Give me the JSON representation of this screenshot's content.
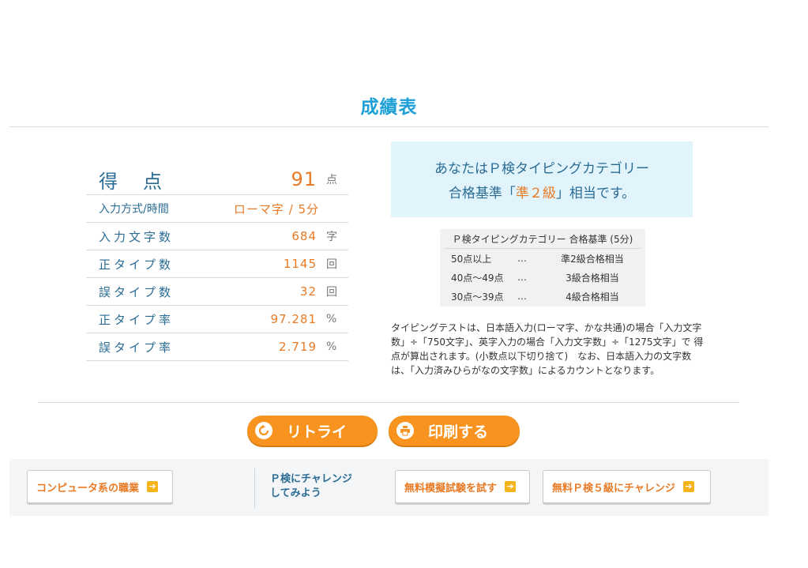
{
  "page_title": "成績表",
  "score_table": {
    "score": {
      "label_a": "得",
      "label_b": "点",
      "value": "91",
      "unit": "点"
    },
    "mode": {
      "label": "入力方式/時間",
      "value": "ローマ字 / 5分"
    },
    "rows": [
      {
        "label": "入力文字数",
        "value": "684",
        "unit": "字"
      },
      {
        "label": "正タイプ数",
        "value": "1145",
        "unit": "回"
      },
      {
        "label": "誤タイプ数",
        "value": "32",
        "unit": "回"
      },
      {
        "label": "正タイプ率",
        "value": "97.281",
        "unit": "%"
      },
      {
        "label": "誤タイプ率",
        "value": "2.719",
        "unit": "%"
      }
    ]
  },
  "result": {
    "line1": "あなたはＰ検タイピングカテゴリー",
    "line2_pre": "合格基準「",
    "grade": "準２級",
    "line2_post": "」相当です。"
  },
  "criteria": {
    "header": "Ｐ検タイピングカテゴリー 合格基準 (5分)",
    "rows": [
      {
        "range": "50点以上",
        "dots": "…",
        "grade": "準2級合格相当"
      },
      {
        "range": "40点～49点",
        "dots": "…",
        "grade": "3級合格相当"
      },
      {
        "range": "30点～39点",
        "dots": "…",
        "grade": "4級合格相当"
      }
    ]
  },
  "note": "タイピングテストは、日本語入力(ローマ字、かな共通)の場合「入力文字数」÷「750文字」、英字入力の場合「入力文字数」÷「1275文字」で 得点が算出されます。(小数点以下切り捨て)　なお、日本語入力の文字数は、「入力済みひらがなの文字数」によるカウントとなります。",
  "buttons": {
    "retry": "リトライ",
    "print": "印刷する"
  },
  "footer": {
    "computer_jobs": "コンピュータ系の職業",
    "challenge_msg_line1": "Ｐ検にチャレンジ",
    "challenge_msg_line2": "してみよう",
    "mock_exam": "無料模擬試験を試す",
    "level5": "無料Ｐ検５級にチャレンジ"
  },
  "icons": {
    "retry": "retry-icon",
    "print": "printer-icon",
    "arrow": "arrow-right-icon"
  },
  "colors": {
    "accent_blue": "#1ca0d6",
    "label_blue": "#2b6c95",
    "orange": "#f7931e",
    "value_orange": "#e87a25"
  }
}
